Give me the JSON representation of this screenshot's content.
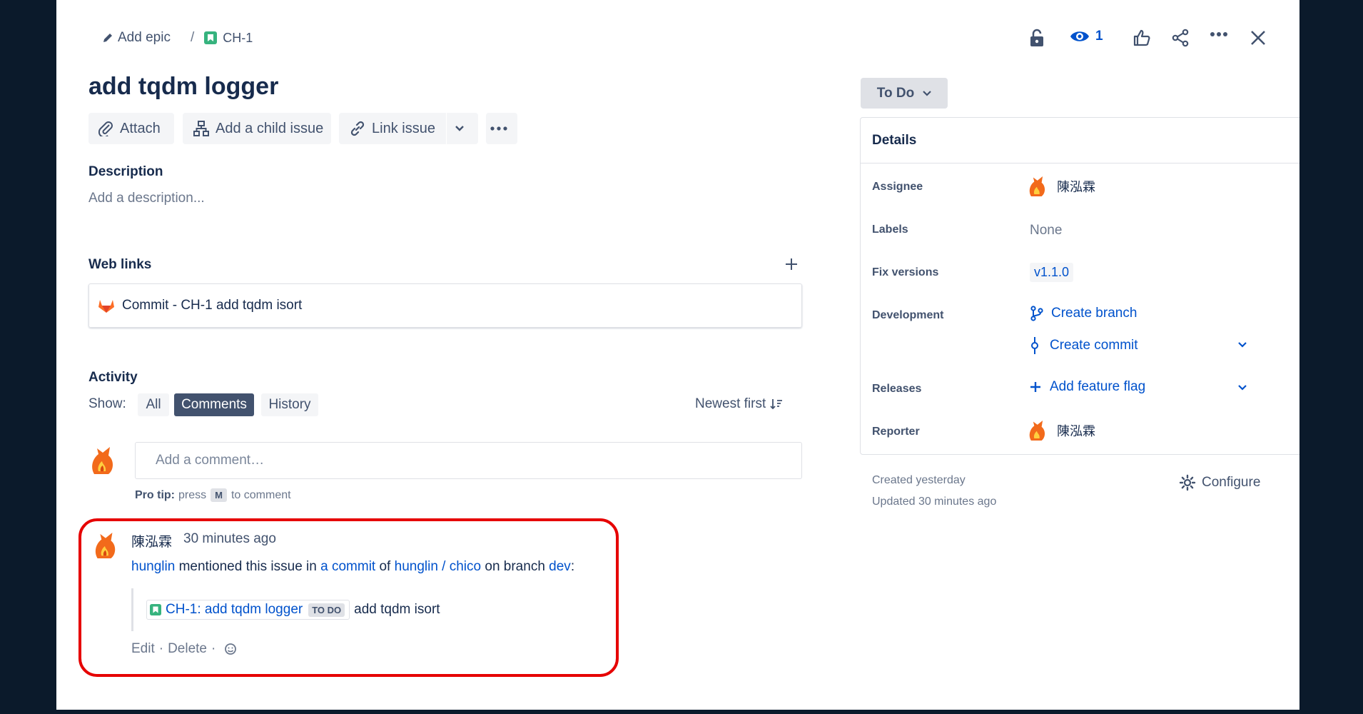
{
  "header": {
    "add_epic": "Add epic",
    "separator": "/",
    "issue_key": "CH-1",
    "watch_count": "1"
  },
  "issue": {
    "title": "add tqdm logger"
  },
  "toolbar": {
    "attach": "Attach",
    "add_child": "Add a child issue",
    "link_issue": "Link issue"
  },
  "description": {
    "heading": "Description",
    "placeholder": "Add a description..."
  },
  "web_links": {
    "heading": "Web links",
    "items": [
      {
        "label": "Commit - CH-1 add tqdm isort"
      }
    ]
  },
  "activity": {
    "heading": "Activity",
    "show_label": "Show:",
    "filters": [
      "All",
      "Comments",
      "History"
    ],
    "active_filter": "Comments",
    "sort": "Newest first",
    "comment_placeholder": "Add a comment…",
    "pro_tip_bold": "Pro tip:",
    "pro_tip_pre": "press",
    "pro_tip_key": "M",
    "pro_tip_post": "to comment"
  },
  "comment": {
    "author": "陳泓霖",
    "time": "30 minutes ago",
    "user_link": "hunglin",
    "text1": "mentioned this issue in",
    "commit_link": "a commit",
    "text2": "of",
    "repo_link": "hunglin / chico",
    "text3": "on branch",
    "branch_link": "dev",
    "colon": ":",
    "issue_ref": "CH-1: add tqdm logger",
    "issue_status": "TO DO",
    "commit_msg": "add tqdm isort",
    "edit": "Edit",
    "delete": "Delete",
    "dot": "·"
  },
  "sidebar": {
    "status": "To Do",
    "details_heading": "Details",
    "fields": {
      "assignee_label": "Assignee",
      "assignee": "陳泓霖",
      "labels_label": "Labels",
      "labels": "None",
      "fix_versions_label": "Fix versions",
      "fix_version": "v1.1.0",
      "development_label": "Development",
      "create_branch": "Create branch",
      "create_commit": "Create commit",
      "releases_label": "Releases",
      "add_feature_flag": "Add feature flag",
      "reporter_label": "Reporter",
      "reporter": "陳泓霖"
    },
    "created": "Created yesterday",
    "updated": "Updated 30 minutes ago",
    "configure": "Configure"
  },
  "colors": {
    "highlight_border": "#e60000",
    "link": "#0052cc",
    "active_filter_bg": "#42526e",
    "story_icon": "#36b37e"
  }
}
